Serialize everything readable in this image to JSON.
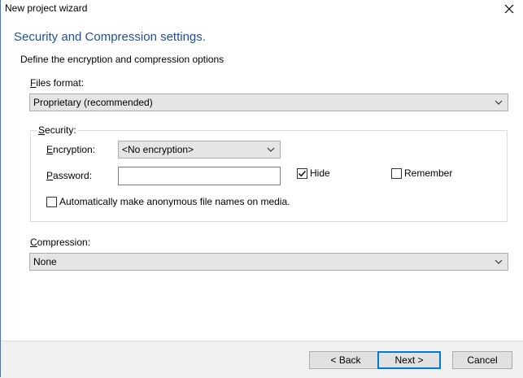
{
  "window": {
    "title": "New project wizard"
  },
  "header": {
    "heading": "Security and Compression settings.",
    "subheading": "Define the encryption and compression options"
  },
  "files_format": {
    "label_prefix": "F",
    "label_rest": "iles format:",
    "selected": "Proprietary (recommended)"
  },
  "security": {
    "group_prefix": "S",
    "group_rest": "ecurity:",
    "encryption_prefix": "E",
    "encryption_rest": "ncryption:",
    "encryption_selected": "<No encryption>",
    "password_prefix": "P",
    "password_rest": "assword:",
    "password_value": "",
    "hide_label": "Hide",
    "hide_checked": true,
    "remember_label": "Remember",
    "remember_checked": false,
    "anon_label": "Automatically make anonymous file names on media.",
    "anon_checked": false
  },
  "compression": {
    "label_prefix": "C",
    "label_rest": "ompression:",
    "selected": "None"
  },
  "footer": {
    "back_label": "< Back",
    "next_label": "Next >",
    "cancel_label": "Cancel"
  },
  "colors": {
    "heading": "#1f4e9a",
    "accent": "#0078d7"
  },
  "icons": {
    "close": "close-icon",
    "chevron": "chevron-down-icon",
    "check": "checkmark-icon"
  }
}
